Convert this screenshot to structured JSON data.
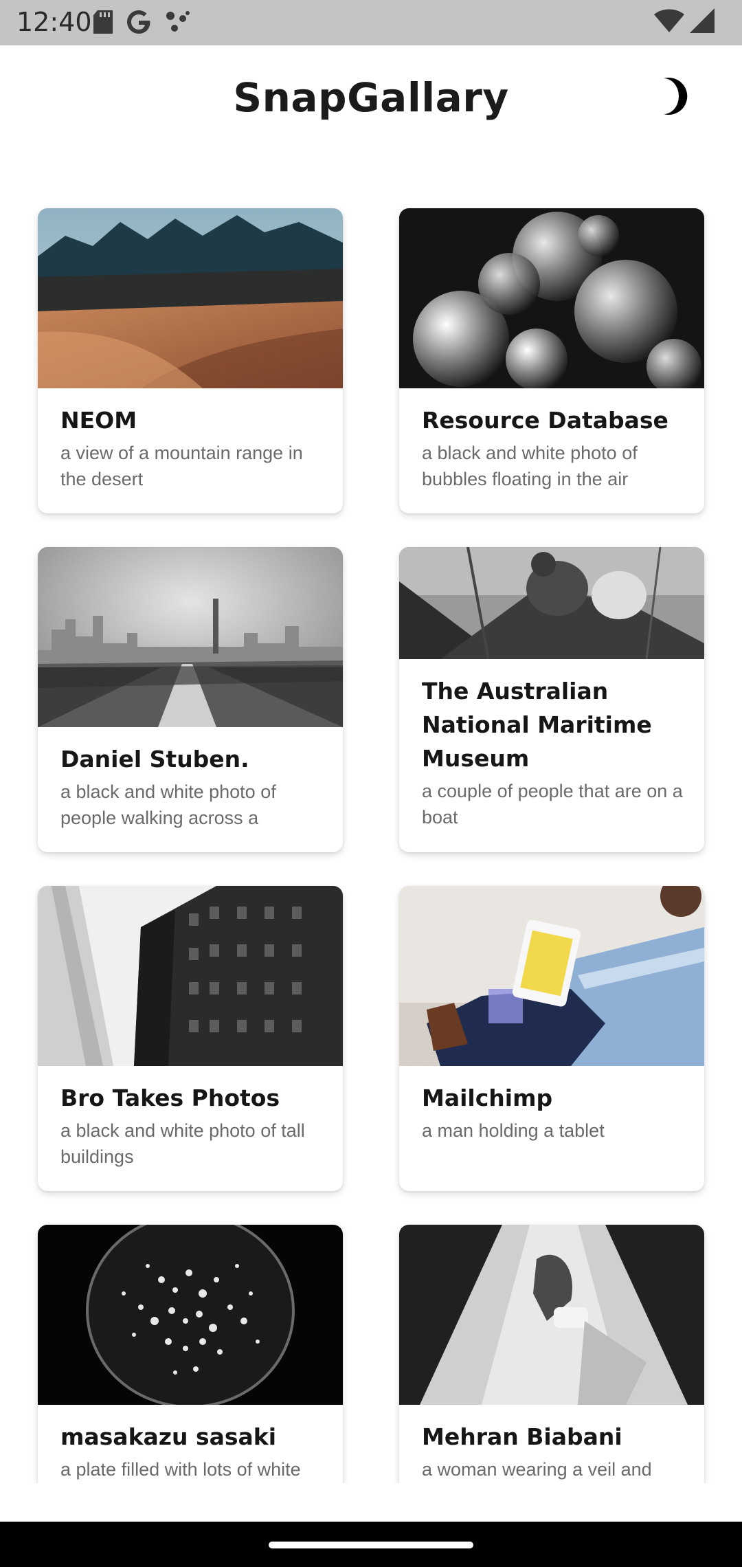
{
  "status_bar": {
    "time": "12:40",
    "icons": [
      "sd-card-icon",
      "google-icon",
      "dots-icon",
      "wifi-icon",
      "signal-icon"
    ]
  },
  "header": {
    "title": "SnapGallary",
    "theme_toggle_icon": "moon-icon"
  },
  "cards": [
    {
      "title": "NEOM",
      "description": "a view of a mountain range in the desert",
      "image": "desert-mountains"
    },
    {
      "title": "Resource Database",
      "description": "a black and white photo of bubbles floating in the air",
      "image": "bubbles"
    },
    {
      "title": "Daniel Stuben.",
      "description": "a black and white photo of people walking across a",
      "image": "bridge-city"
    },
    {
      "title": "The Australian National Maritime Museum",
      "description": "a couple of people that are on a boat",
      "image": "boat-people"
    },
    {
      "title": "Bro Takes Photos",
      "description": "a black and white photo of tall buildings",
      "image": "tall-buildings"
    },
    {
      "title": "Mailchimp",
      "description": "a man holding a tablet",
      "image": "man-tablet"
    },
    {
      "title": "masakazu sasaki",
      "description": "a plate filled with lots of white",
      "image": "petri-dish"
    },
    {
      "title": "Mehran Biabani",
      "description": "a woman wearing a veil and",
      "image": "veil-woman"
    }
  ],
  "colors": {
    "status_bar_bg": "#c4c4c4",
    "background": "#ffffff",
    "title_text": "#161616",
    "description_text": "#6a6a6a",
    "nav_bar_bg": "#000000"
  }
}
